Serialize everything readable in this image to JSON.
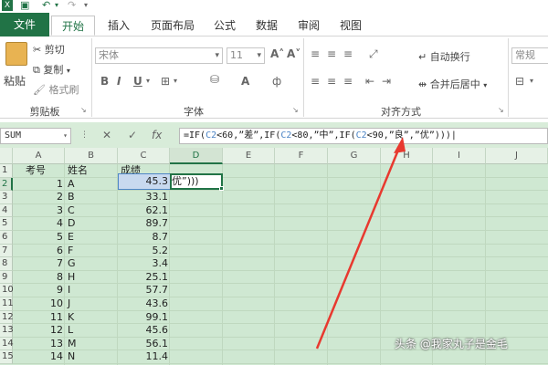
{
  "quick_access": {
    "app_icon": "excel-icon",
    "save_icon": "save-icon",
    "undo_icon": "undo-icon",
    "redo_icon": "redo-icon"
  },
  "tabs": [
    "文件",
    "开始",
    "插入",
    "页面布局",
    "公式",
    "数据",
    "审阅",
    "视图"
  ],
  "ribbon": {
    "clipboard": {
      "paste": "粘贴",
      "cut": "剪切",
      "copy": "复制",
      "format_painter": "格式刷",
      "group_label": "剪贴板"
    },
    "font": {
      "font_name": "宋体",
      "font_size": "11",
      "bold": "B",
      "italic": "I",
      "underline": "U",
      "group_label": "字体"
    },
    "alignment": {
      "wrap": "自动换行",
      "merge": "合并后居中",
      "group_label": "对齐方式"
    },
    "number": {
      "format": "常规"
    }
  },
  "formula_bar": {
    "name_box": "SUM",
    "cancel": "✕",
    "enter": "✓",
    "fx": "fx",
    "formula_parts": [
      {
        "t": "=IF(",
        "ref": false
      },
      {
        "t": "C2",
        "ref": true
      },
      {
        "t": "<60,”差”,IF(",
        "ref": false
      },
      {
        "t": "C2",
        "ref": true
      },
      {
        "t": "<80,”中”,IF(",
        "ref": false
      },
      {
        "t": "C2",
        "ref": true
      },
      {
        "t": "<90,”良”,”优”)))",
        "ref": false
      }
    ]
  },
  "sheet": {
    "columns": [
      "A",
      "B",
      "C",
      "D",
      "E",
      "F",
      "G",
      "H",
      "I",
      "J"
    ],
    "rows": [
      {
        "n": "1",
        "a": "考号",
        "b": "姓名",
        "c": "成绩"
      },
      {
        "n": "2",
        "a": "1",
        "b": "A",
        "c": "45.3"
      },
      {
        "n": "3",
        "a": "2",
        "b": "B",
        "c": "33.1"
      },
      {
        "n": "4",
        "a": "3",
        "b": "C",
        "c": "62.1"
      },
      {
        "n": "5",
        "a": "4",
        "b": "D",
        "c": "89.7"
      },
      {
        "n": "6",
        "a": "5",
        "b": "E",
        "c": "8.7"
      },
      {
        "n": "7",
        "a": "6",
        "b": "F",
        "c": "5.2"
      },
      {
        "n": "8",
        "a": "7",
        "b": "G",
        "c": "3.4"
      },
      {
        "n": "9",
        "a": "8",
        "b": "H",
        "c": "25.1"
      },
      {
        "n": "10",
        "a": "9",
        "b": "I",
        "c": "57.7"
      },
      {
        "n": "11",
        "a": "10",
        "b": "J",
        "c": "43.6"
      },
      {
        "n": "12",
        "a": "11",
        "b": "K",
        "c": "99.1"
      },
      {
        "n": "13",
        "a": "12",
        "b": "L",
        "c": "45.6"
      },
      {
        "n": "14",
        "a": "13",
        "b": "M",
        "c": "56.1"
      },
      {
        "n": "15",
        "a": "14",
        "b": "N",
        "c": "11.4"
      }
    ],
    "editing_cell_text": "优”)))"
  },
  "watermark": "头条 @我家丸子是金毛",
  "colors": {
    "excel_green": "#217346",
    "sheet_bg": "#cfe8d2",
    "arrow": "#e8392f"
  }
}
